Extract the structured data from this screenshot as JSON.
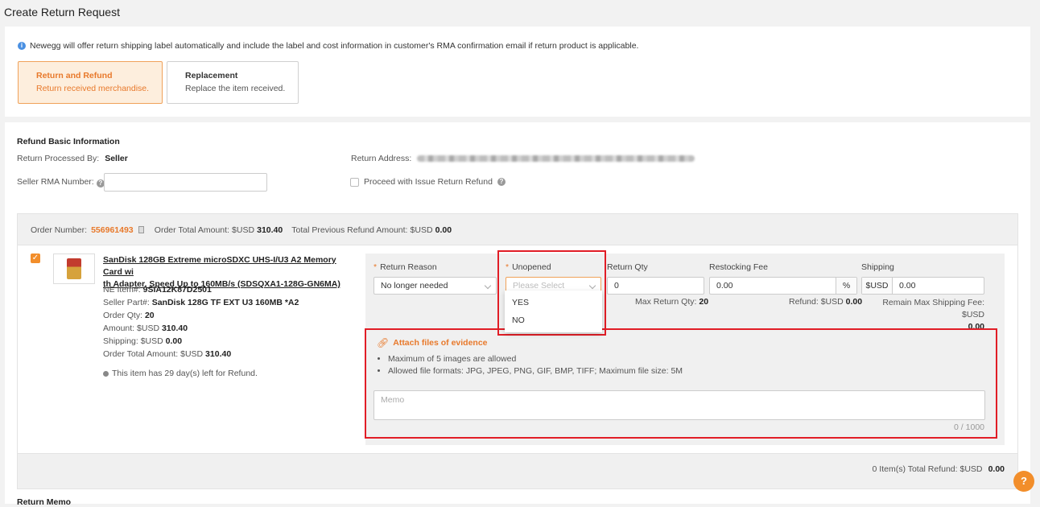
{
  "page": {
    "title": "Create Return Request"
  },
  "notice": {
    "text": "Newegg will offer return shipping label automatically and include the label and cost information in customer's RMA confirmation email if return product is applicable."
  },
  "options": [
    {
      "title": "Return and Refund",
      "subtitle": "Return received merchandise."
    },
    {
      "title": "Replacement",
      "subtitle": "Replace the item received."
    }
  ],
  "refund_basic": {
    "heading": "Refund Basic Information",
    "processed_by_label": "Return Processed By:",
    "processed_by_value": "Seller",
    "seller_rma_label": "Seller RMA Number:",
    "seller_rma_value": "",
    "return_address_label": "Return Address:",
    "proceed_label": "Proceed with Issue Return Refund"
  },
  "order": {
    "number_label": "Order Number:",
    "number": "556961493",
    "total_label": "Order Total Amount:",
    "total_currency": "$USD",
    "total_value": "310.40",
    "prev_refund_label": "Total Previous Refund Amount:",
    "prev_refund_currency": "$USD",
    "prev_refund_value": "0.00"
  },
  "item": {
    "title_line1": "SanDisk 128GB Extreme microSDXC UHS-I/U3 A2 Memory Card wi",
    "title_line2": "th Adapter, Speed Up to 160MB/s (SDSQXA1-128G-GN6MA)",
    "ne_item_label": "NE Item#:",
    "ne_item": "9SIA12K87D2501",
    "seller_part_label": "Seller Part#:",
    "seller_part": "SanDisk 128G TF EXT U3 160MB *A2",
    "order_qty_label": "Order Qty:",
    "order_qty": "20",
    "amount_label": "Amount:",
    "amount_currency": "$USD",
    "amount": "310.40",
    "shipping_label": "Shipping:",
    "shipping_currency": "$USD",
    "shipping": "0.00",
    "order_total_label": "Order Total Amount:",
    "order_total_currency": "$USD",
    "order_total": "310.40",
    "days_left": "This item has 29 day(s) left for Refund."
  },
  "form": {
    "return_reason_label": "Return Reason",
    "return_reason_value": "No longer needed",
    "unopened_label": "Unopened",
    "unopened_placeholder": "Please Select",
    "unopened_options": [
      "YES",
      "NO"
    ],
    "return_qty_label": "Return Qty",
    "return_qty_value": "0",
    "max_return_qty_label": "Max Return Qty:",
    "max_return_qty": "20",
    "restocking_label": "Restocking Fee",
    "restocking_value": "0.00",
    "restocking_suffix": "%",
    "refund_label": "Refund: $USD",
    "refund_value": "0.00",
    "shipping_label": "Shipping",
    "shipping_prefix": "$USD",
    "shipping_value": "0.00",
    "remain_max_label": "Remain Max Shipping Fee: $USD",
    "remain_max_value": "0.00"
  },
  "evidence": {
    "link_label": "Attach files of evidence",
    "rules": [
      "Maximum of 5 images are allowed",
      "Allowed file formats: JPG, JPEG, PNG, GIF, BMP, TIFF; Maximum file size: 5M"
    ],
    "memo_placeholder": "Memo",
    "counter": "0 / 1000"
  },
  "footer": {
    "total_label": "0 Item(s) Total Refund: $USD",
    "total_value": "0.00"
  },
  "return_memo_heading": "Return Memo",
  "colors": {
    "accent": "#e8792b",
    "highlight": "#e11d26",
    "info": "#4a90e2"
  }
}
